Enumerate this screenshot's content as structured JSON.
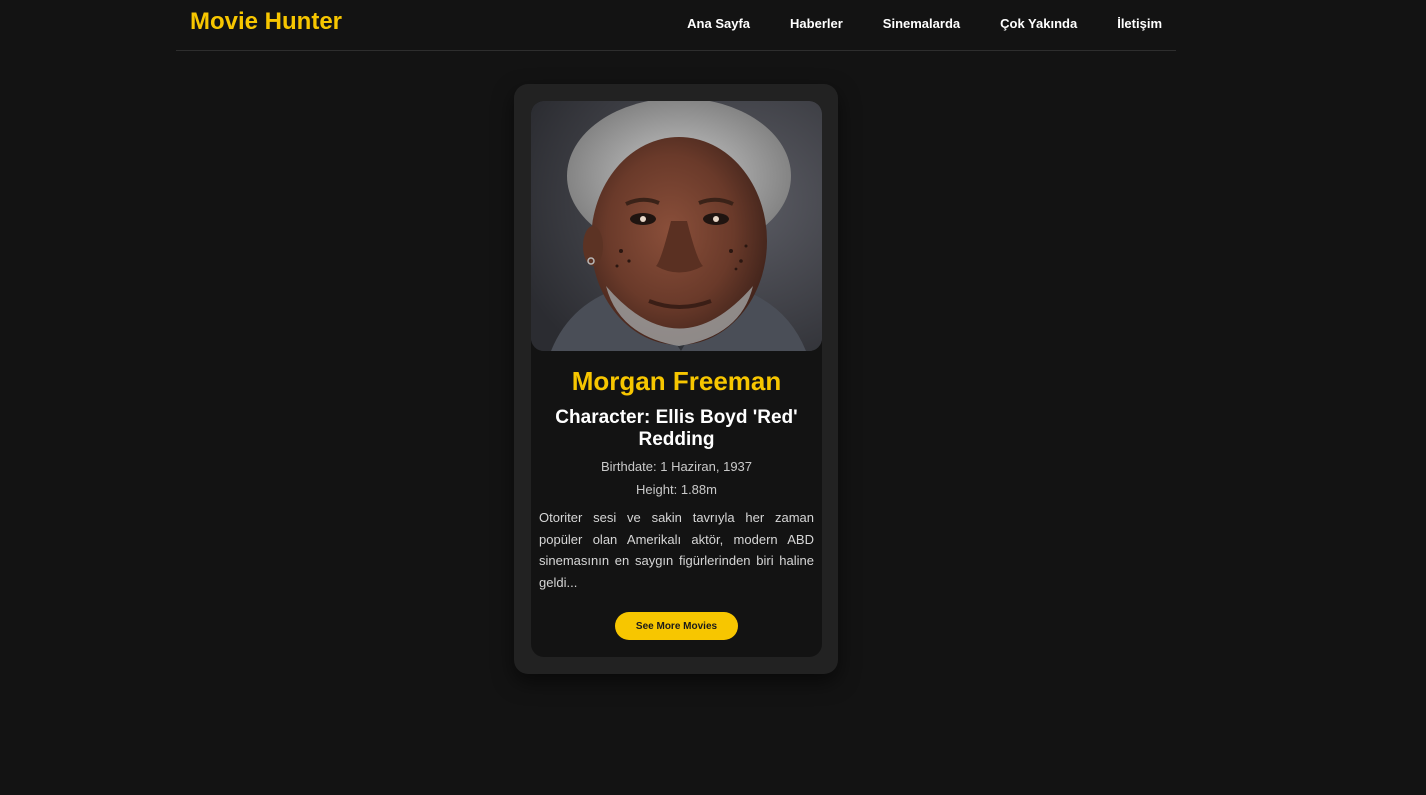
{
  "brand": "Movie Hunter",
  "nav": [
    {
      "label": "Ana Sayfa"
    },
    {
      "label": "Haberler"
    },
    {
      "label": "Sinemalarda"
    },
    {
      "label": "Çok Yakında"
    },
    {
      "label": "İletişim"
    }
  ],
  "actor": {
    "name": "Morgan Freeman",
    "character": "Character: Ellis Boyd 'Red' Redding",
    "birthdate": "Birthdate: 1 Haziran, 1937",
    "height": "Height: 1.88m",
    "bio": "Otoriter sesi ve sakin tavrıyla her zaman popüler olan Amerikalı aktör, modern ABD sinemasının en saygın figürlerinden biri haline geldi...",
    "button_label": "See More Movies"
  },
  "colors": {
    "accent": "#f7c600",
    "background": "#131313",
    "card": "#222222"
  }
}
